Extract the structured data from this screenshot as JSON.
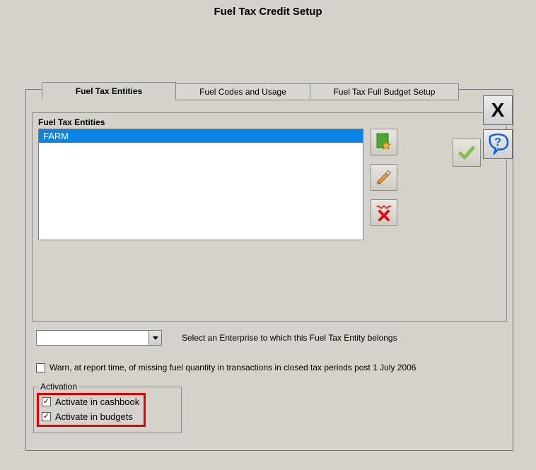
{
  "window": {
    "title": "Fuel Tax Credit Setup"
  },
  "tabs": {
    "t1": "Fuel Tax Entities",
    "t2": "Fuel Codes and Usage",
    "t3": "Fuel Tax Full Budget Setup"
  },
  "panel": {
    "entities_label": "Fuel Tax Entities",
    "list": {
      "item0": "FARM"
    }
  },
  "enterprise": {
    "combo_value": "",
    "hint": "Select an Enterprise to which this Fuel Tax Entity belongs"
  },
  "warn": {
    "checked": false,
    "label": "Warn, at report time, of missing fuel quantity in transactions in closed tax periods post 1 July 2006"
  },
  "activation": {
    "legend": "Activation",
    "cashbook": {
      "label": "Activate in cashbook",
      "checked": true
    },
    "budgets": {
      "label": "Activate in budgets",
      "checked": true
    }
  },
  "buttons": {
    "close_glyph": "X",
    "help_glyph": "?"
  }
}
